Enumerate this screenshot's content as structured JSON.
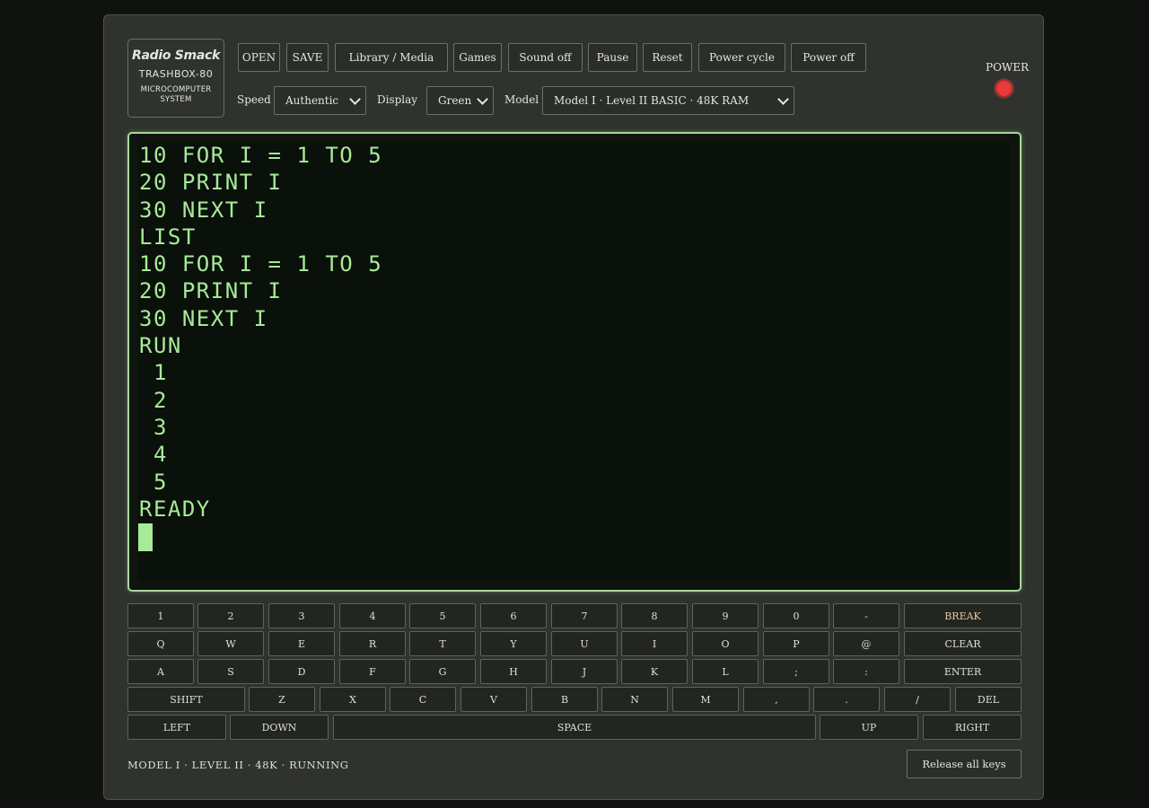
{
  "badge": {
    "brand": "Radio Smack",
    "model": "TRASHBOX-80",
    "sub_line1": "MICROCOMPUTER",
    "sub_line2": "SYSTEM"
  },
  "toolbar": {
    "open": "OPEN",
    "save": "SAVE",
    "library": "Library / Media",
    "games": "Games",
    "sound": "Sound off",
    "pause": "Pause",
    "reset": "Reset",
    "power_cycle": "Power cycle",
    "power_off": "Power off"
  },
  "settings": {
    "speed_label": "Speed",
    "speed_value": "Authentic",
    "display_label": "Display",
    "display_value": "Green",
    "model_label": "Model",
    "model_value": "Model I · Level II BASIC · 48K RAM"
  },
  "power": {
    "label": "POWER",
    "led_color": "#e83a3a"
  },
  "screen": {
    "lines": [
      "10 FOR I = 1 TO 5",
      "20 PRINT I",
      "30 NEXT I",
      "LIST",
      "10 FOR I = 1 TO 5",
      "20 PRINT I",
      "30 NEXT I",
      "RUN",
      " 1",
      " 2",
      " 3",
      " 4",
      " 5",
      "READY"
    ],
    "phosphor_color": "#a7ea98"
  },
  "keyboard": {
    "rows": [
      [
        "1",
        "2",
        "3",
        "4",
        "5",
        "6",
        "7",
        "8",
        "9",
        "0",
        "-",
        "BREAK"
      ],
      [
        "Q",
        "W",
        "E",
        "R",
        "T",
        "Y",
        "U",
        "I",
        "O",
        "P",
        "@",
        "CLEAR"
      ],
      [
        "A",
        "S",
        "D",
        "F",
        "G",
        "H",
        "J",
        "K",
        "L",
        ";",
        ":",
        "ENTER"
      ],
      [
        "SHIFT",
        "Z",
        "X",
        "C",
        "V",
        "B",
        "N",
        "M",
        ",",
        ".",
        "/",
        "DEL"
      ],
      [
        "LEFT",
        "DOWN",
        "SPACE",
        "UP",
        "RIGHT"
      ]
    ]
  },
  "footer": {
    "status": "MODEL I · LEVEL II · 48K · RUNNING",
    "release_keys": "Release all keys"
  }
}
